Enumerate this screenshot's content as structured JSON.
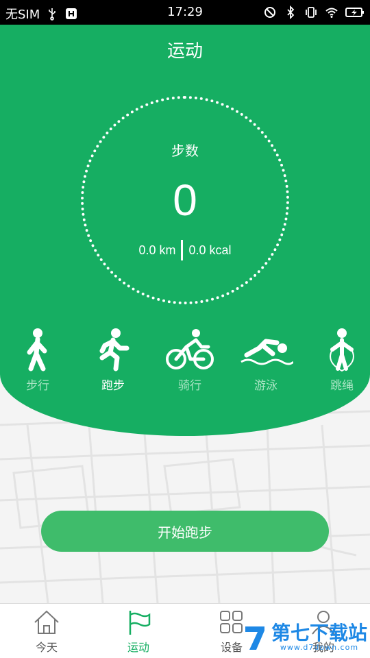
{
  "status_bar": {
    "carrier": "无SIM",
    "time": "17:29"
  },
  "header": {
    "title": "运动"
  },
  "counter": {
    "label": "步数",
    "value": "0",
    "distance": "0.0 km",
    "calories": "0.0 kcal"
  },
  "sports": [
    {
      "label": "步行",
      "icon": "walk-icon"
    },
    {
      "label": "跑步",
      "icon": "run-icon"
    },
    {
      "label": "骑行",
      "icon": "bike-icon"
    },
    {
      "label": "游泳",
      "icon": "swim-icon"
    },
    {
      "label": "跳绳",
      "icon": "jump-rope-icon"
    }
  ],
  "selected_sport": "跑步",
  "start_button": {
    "label": "开始跑步"
  },
  "tabs": [
    {
      "label": "今天",
      "icon": "home-icon"
    },
    {
      "label": "运动",
      "icon": "flag-icon"
    },
    {
      "label": "设备",
      "icon": "grid-icon"
    },
    {
      "label": "我的",
      "icon": "user-icon"
    }
  ],
  "active_tab": "运动",
  "watermark": {
    "text": "第七下载站",
    "url": "www.d7down.com"
  },
  "colors": {
    "primary": "#16ae62",
    "button": "#3fbc6b",
    "inactive_label": "#a8e4c3"
  }
}
